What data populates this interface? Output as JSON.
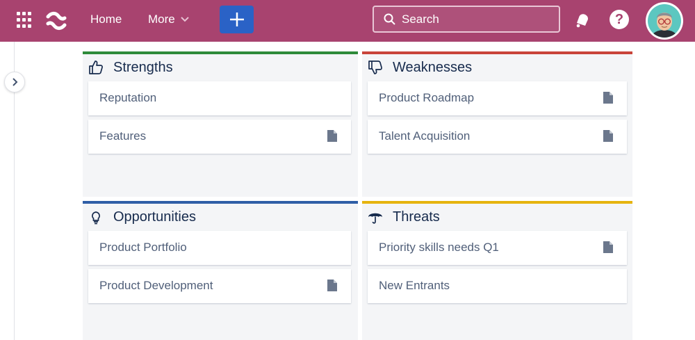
{
  "topbar": {
    "home_label": "Home",
    "more_label": "More",
    "search_placeholder": "Search",
    "help_label": "?",
    "bg_color": "#a8436f",
    "create_color": "#2a62c6"
  },
  "quadrants": {
    "strengths": {
      "title": "Strengths",
      "icon": "thumbs-up-icon",
      "accent": "#2e8b3a",
      "cards": [
        {
          "label": "Reputation",
          "has_doc": false
        },
        {
          "label": "Features",
          "has_doc": true
        }
      ]
    },
    "weaknesses": {
      "title": "Weaknesses",
      "icon": "thumbs-down-icon",
      "accent": "#c9443a",
      "cards": [
        {
          "label": "Product Roadmap",
          "has_doc": true
        },
        {
          "label": "Talent Acquisition",
          "has_doc": true
        }
      ]
    },
    "opportunities": {
      "title": "Opportunities",
      "icon": "lightbulb-icon",
      "accent": "#2f5ea6",
      "cards": [
        {
          "label": "Product Portfolio",
          "has_doc": false
        },
        {
          "label": "Product Development",
          "has_doc": true
        }
      ]
    },
    "threats": {
      "title": "Threats",
      "icon": "umbrella-icon",
      "accent": "#e6b40f",
      "cards": [
        {
          "label": "Priority skills needs Q1",
          "has_doc": true
        },
        {
          "label": "New Entrants",
          "has_doc": false
        }
      ]
    }
  }
}
